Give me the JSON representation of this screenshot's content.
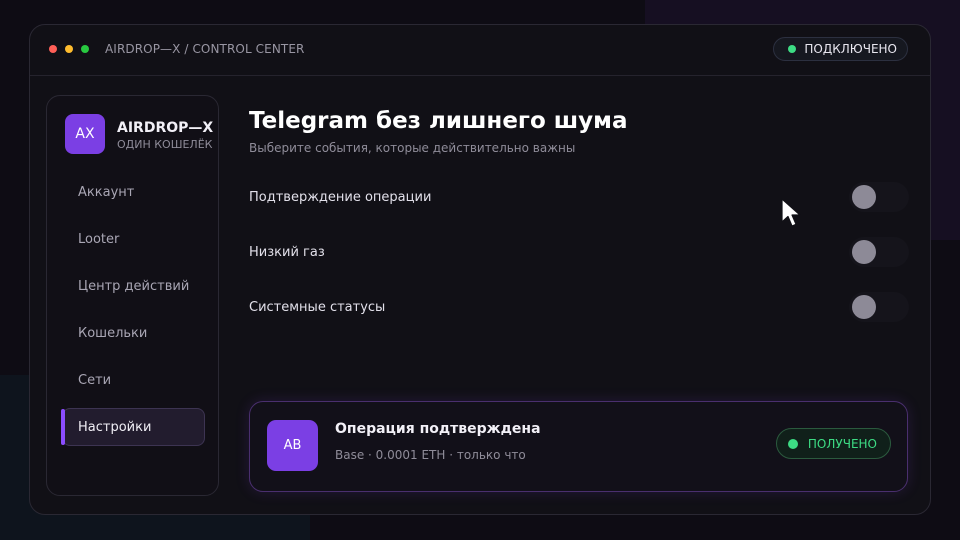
{
  "window": {
    "title": "AIRDROP—X / CONTROL CENTER",
    "connection_status": "ПОДКЛЮЧЕНО"
  },
  "sidebar": {
    "avatar_initials": "AX",
    "brand_name": "AIRDROP—X",
    "brand_subtitle": "ОДИН КОШЕЛЁК",
    "items": [
      {
        "label": "Аккаунт",
        "active": false
      },
      {
        "label": "Looter",
        "active": false
      },
      {
        "label": "Центр действий",
        "active": false
      },
      {
        "label": "Кошельки",
        "active": false
      },
      {
        "label": "Сети",
        "active": false
      },
      {
        "label": "Настройки",
        "active": true
      }
    ]
  },
  "main": {
    "title": "Telegram без лишнего шума",
    "subtitle": "Выберите события, которые действительно важны",
    "settings": [
      {
        "label": "Подтверждение операции",
        "enabled": false
      },
      {
        "label": "Низкий газ",
        "enabled": false
      },
      {
        "label": "Системные статусы",
        "enabled": false
      }
    ]
  },
  "notification": {
    "avatar_initials": "AB",
    "title": "Операция подтверждена",
    "subtitle": "Base · 0.0001 ETH · только что",
    "status": "ПОЛУЧЕНО"
  },
  "colors": {
    "accent": "#7b3fe4",
    "active_indicator": "#8b4dff",
    "success": "#3ddc84"
  },
  "icons": {
    "window_controls": [
      "close-dot-icon",
      "minimize-dot-icon",
      "maximize-dot-icon"
    ],
    "pointer": "mouse-cursor-icon"
  }
}
